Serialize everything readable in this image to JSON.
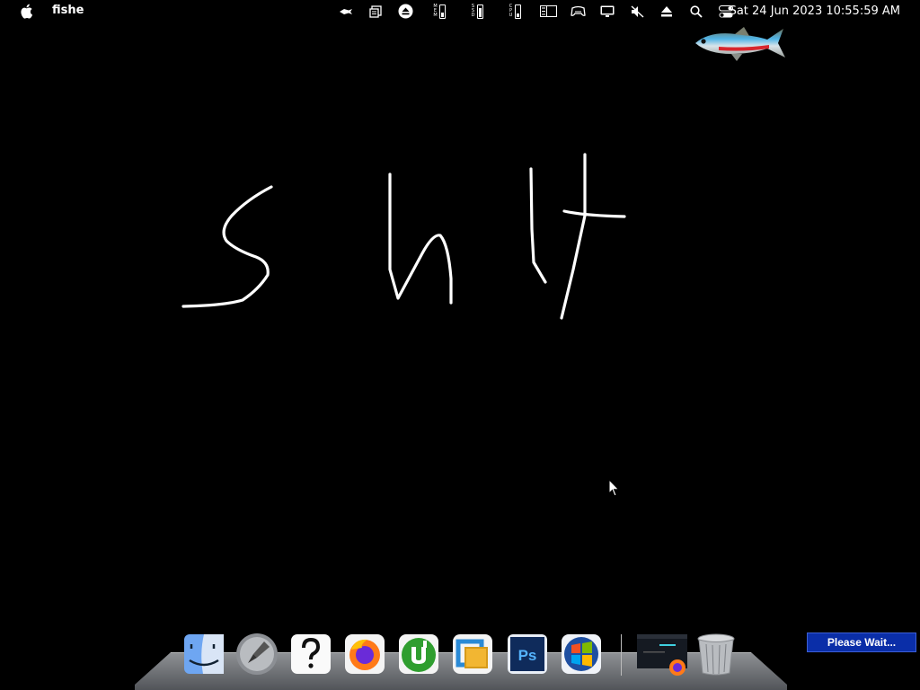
{
  "menubar": {
    "app_name": "fishe",
    "clock": "Sat 24 Jun 2023 10:55:59 AM",
    "stats": [
      {
        "label": "MEM",
        "level": 0.45
      },
      {
        "label": "SSD",
        "level": 0.85
      },
      {
        "label": "CPU",
        "level": 0.3
      }
    ],
    "tray_icons": [
      "fish-tray-icon",
      "clipboard-icon",
      "eject-circle-icon",
      "list-icon",
      "gamepad-icon",
      "display-icon",
      "volume-mute-icon",
      "eject-icon",
      "search-icon",
      "control-center-icon"
    ]
  },
  "desktop": {
    "handwriting_text": "shit"
  },
  "dock": {
    "items": [
      "finder-icon",
      "launchpad-icon",
      "help-icon",
      "firefox-icon",
      "utorrent-icon",
      "vmware-icon",
      "photoshop-icon",
      "windows-icon",
      "firefox-window-thumbnail",
      "trash-icon"
    ]
  },
  "status": {
    "please_wait": "Please Wait..."
  },
  "colors": {
    "background": "#000000",
    "please_wait_bg": "#0a2ea8"
  }
}
